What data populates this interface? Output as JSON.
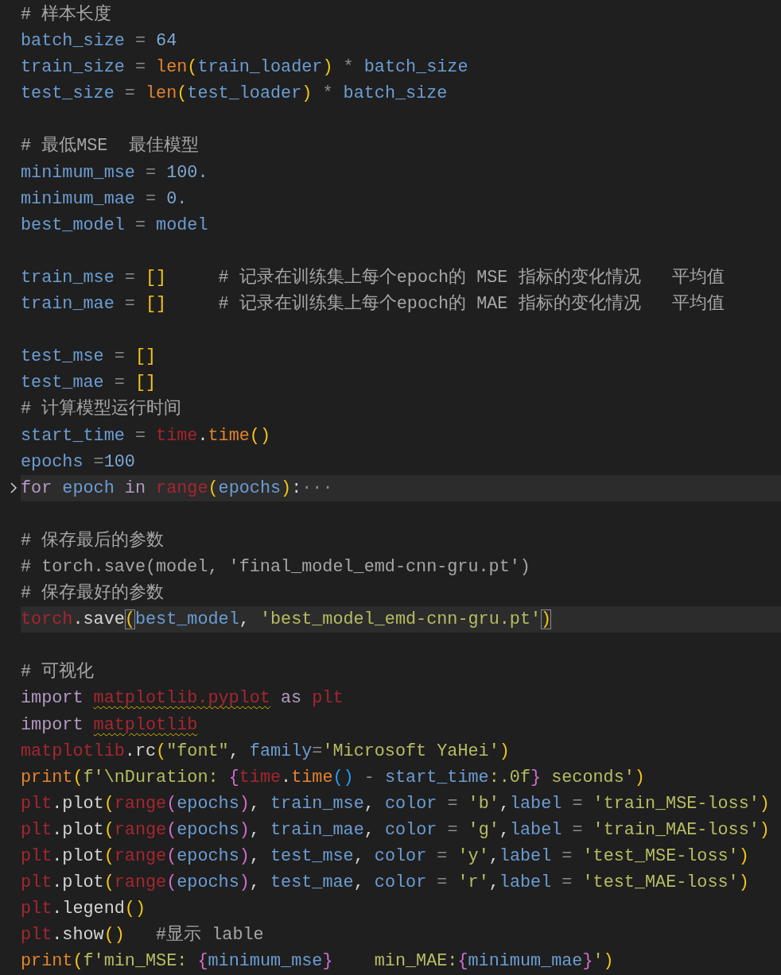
{
  "editor": {
    "lines": [
      {
        "kind": "code",
        "tokens": [
          {
            "text": "# 样本长度",
            "kind": "comment"
          }
        ]
      },
      {
        "kind": "code",
        "tokens": [
          {
            "text": "batch_size",
            "kind": "var"
          },
          {
            "text": " = ",
            "kind": "op"
          },
          {
            "text": "64",
            "kind": "num"
          }
        ]
      },
      {
        "kind": "code",
        "tokens": [
          {
            "text": "train_size",
            "kind": "var"
          },
          {
            "text": " = ",
            "kind": "op"
          },
          {
            "text": "len",
            "kind": "func"
          },
          {
            "text": "(",
            "kind": "bracket1"
          },
          {
            "text": "train_loader",
            "kind": "var"
          },
          {
            "text": ")",
            "kind": "bracket1"
          },
          {
            "text": " * ",
            "kind": "op"
          },
          {
            "text": "batch_size",
            "kind": "var"
          }
        ]
      },
      {
        "kind": "code",
        "tokens": [
          {
            "text": "test_size",
            "kind": "var"
          },
          {
            "text": " = ",
            "kind": "op"
          },
          {
            "text": "len",
            "kind": "func"
          },
          {
            "text": "(",
            "kind": "bracket1"
          },
          {
            "text": "test_loader",
            "kind": "var"
          },
          {
            "text": ")",
            "kind": "bracket1"
          },
          {
            "text": " * ",
            "kind": "op"
          },
          {
            "text": "batch_size",
            "kind": "var"
          }
        ]
      },
      {
        "kind": "blank"
      },
      {
        "kind": "code",
        "tokens": [
          {
            "text": "# 最低MSE  最佳模型",
            "kind": "comment"
          }
        ]
      },
      {
        "kind": "code",
        "tokens": [
          {
            "text": "minimum_mse",
            "kind": "var"
          },
          {
            "text": " = ",
            "kind": "op"
          },
          {
            "text": "100.",
            "kind": "num"
          }
        ]
      },
      {
        "kind": "code",
        "tokens": [
          {
            "text": "minimum_mae",
            "kind": "var"
          },
          {
            "text": " = ",
            "kind": "op"
          },
          {
            "text": "0.",
            "kind": "num"
          }
        ]
      },
      {
        "kind": "code",
        "tokens": [
          {
            "text": "best_model",
            "kind": "var"
          },
          {
            "text": " = ",
            "kind": "op"
          },
          {
            "text": "model",
            "kind": "var"
          }
        ]
      },
      {
        "kind": "blank"
      },
      {
        "kind": "code",
        "tokens": [
          {
            "text": "train_mse",
            "kind": "var"
          },
          {
            "text": " = ",
            "kind": "op"
          },
          {
            "text": "[]",
            "kind": "bracket1"
          },
          {
            "text": "     # 记录在训练集上每个epoch的 MSE 指标的变化情况   平均值",
            "kind": "comment"
          }
        ]
      },
      {
        "kind": "code",
        "tokens": [
          {
            "text": "train_mae",
            "kind": "var"
          },
          {
            "text": " = ",
            "kind": "op"
          },
          {
            "text": "[]",
            "kind": "bracket1"
          },
          {
            "text": "     # 记录在训练集上每个epoch的 MAE 指标的变化情况   平均值",
            "kind": "comment"
          }
        ]
      },
      {
        "kind": "blank"
      },
      {
        "kind": "code",
        "tokens": [
          {
            "text": "test_mse",
            "kind": "var"
          },
          {
            "text": " = ",
            "kind": "op"
          },
          {
            "text": "[]",
            "kind": "bracket1"
          }
        ]
      },
      {
        "kind": "code",
        "tokens": [
          {
            "text": "test_mae",
            "kind": "var"
          },
          {
            "text": " = ",
            "kind": "op"
          },
          {
            "text": "[]",
            "kind": "bracket1"
          }
        ]
      },
      {
        "kind": "code",
        "tokens": [
          {
            "text": "# 计算模型运行时间",
            "kind": "comment"
          }
        ]
      },
      {
        "kind": "code",
        "tokens": [
          {
            "text": "start_time",
            "kind": "var"
          },
          {
            "text": " = ",
            "kind": "op"
          },
          {
            "text": "time",
            "kind": "module"
          },
          {
            "text": ".",
            "kind": "plain"
          },
          {
            "text": "time",
            "kind": "func"
          },
          {
            "text": "()",
            "kind": "bracket1"
          }
        ]
      },
      {
        "kind": "code",
        "tokens": [
          {
            "text": "epochs",
            "kind": "var"
          },
          {
            "text": " =",
            "kind": "op"
          },
          {
            "text": "100",
            "kind": "num"
          }
        ]
      },
      {
        "kind": "code",
        "highlighted": true,
        "folded": true,
        "tokens": [
          {
            "text": "for ",
            "kind": "keyword"
          },
          {
            "text": "epoch",
            "kind": "var"
          },
          {
            "text": " in ",
            "kind": "keyword"
          },
          {
            "text": "range",
            "kind": "module"
          },
          {
            "text": "(",
            "kind": "bracket1"
          },
          {
            "text": "epochs",
            "kind": "var"
          },
          {
            "text": ")",
            "kind": "bracket1"
          },
          {
            "text": ":",
            "kind": "plain"
          },
          {
            "text": "···",
            "kind": "op"
          }
        ]
      },
      {
        "kind": "blank"
      },
      {
        "kind": "code",
        "tokens": [
          {
            "text": "# 保存最后的参数",
            "kind": "comment"
          }
        ]
      },
      {
        "kind": "code",
        "tokens": [
          {
            "text": "# torch.save(model, 'final_model_emd-cnn-gru.pt')",
            "kind": "comment"
          }
        ]
      },
      {
        "kind": "code",
        "tokens": [
          {
            "text": "# 保存最好的参数",
            "kind": "comment"
          }
        ]
      },
      {
        "kind": "code",
        "highlighted": true,
        "tokens": [
          {
            "text": "torch",
            "kind": "module"
          },
          {
            "text": ".save",
            "kind": "plain"
          },
          {
            "text": "(",
            "kind": "bracket1",
            "matched": true
          },
          {
            "text": "best_model",
            "kind": "var"
          },
          {
            "text": ", ",
            "kind": "plain"
          },
          {
            "text": "'best_model_emd-cnn-gru.pt'",
            "kind": "string"
          },
          {
            "text": ")",
            "kind": "bracket1",
            "matched": true
          }
        ]
      },
      {
        "kind": "blank"
      },
      {
        "kind": "code",
        "tokens": [
          {
            "text": "# 可视化",
            "kind": "comment"
          }
        ]
      },
      {
        "kind": "code",
        "tokens": [
          {
            "text": "import ",
            "kind": "keyword"
          },
          {
            "text": "matplotlib.pyplot",
            "kind": "module",
            "squiggle": true
          },
          {
            "text": " as ",
            "kind": "keyword"
          },
          {
            "text": "plt",
            "kind": "module"
          }
        ]
      },
      {
        "kind": "code",
        "tokens": [
          {
            "text": "import ",
            "kind": "keyword"
          },
          {
            "text": "matplotlib",
            "kind": "module",
            "squiggle": true
          }
        ]
      },
      {
        "kind": "code",
        "tokens": [
          {
            "text": "matplotlib",
            "kind": "module"
          },
          {
            "text": ".rc",
            "kind": "plain"
          },
          {
            "text": "(",
            "kind": "bracket1"
          },
          {
            "text": "\"font\"",
            "kind": "string"
          },
          {
            "text": ", ",
            "kind": "plain"
          },
          {
            "text": "family",
            "kind": "var"
          },
          {
            "text": "=",
            "kind": "op"
          },
          {
            "text": "'Microsoft YaHei'",
            "kind": "string"
          },
          {
            "text": ")",
            "kind": "bracket1"
          }
        ]
      },
      {
        "kind": "code",
        "tokens": [
          {
            "text": "print",
            "kind": "func"
          },
          {
            "text": "(",
            "kind": "bracket1"
          },
          {
            "text": "f'\\nDuration: ",
            "kind": "string"
          },
          {
            "text": "{",
            "kind": "bracket2"
          },
          {
            "text": "time",
            "kind": "module"
          },
          {
            "text": ".",
            "kind": "plain"
          },
          {
            "text": "time",
            "kind": "func"
          },
          {
            "text": "()",
            "kind": "bracket3"
          },
          {
            "text": " - ",
            "kind": "op"
          },
          {
            "text": "start_time",
            "kind": "var"
          },
          {
            "text": ":.0f",
            "kind": "string"
          },
          {
            "text": "}",
            "kind": "bracket2"
          },
          {
            "text": " seconds'",
            "kind": "string"
          },
          {
            "text": ")",
            "kind": "bracket1"
          }
        ]
      },
      {
        "kind": "code",
        "tokens": [
          {
            "text": "plt",
            "kind": "module"
          },
          {
            "text": ".plot",
            "kind": "plain"
          },
          {
            "text": "(",
            "kind": "bracket1"
          },
          {
            "text": "range",
            "kind": "module"
          },
          {
            "text": "(",
            "kind": "bracket2"
          },
          {
            "text": "epochs",
            "kind": "var"
          },
          {
            "text": ")",
            "kind": "bracket2"
          },
          {
            "text": ", ",
            "kind": "plain"
          },
          {
            "text": "train_mse",
            "kind": "var"
          },
          {
            "text": ", ",
            "kind": "plain"
          },
          {
            "text": "color",
            "kind": "var"
          },
          {
            "text": " = ",
            "kind": "op"
          },
          {
            "text": "'b'",
            "kind": "string"
          },
          {
            "text": ",",
            "kind": "plain"
          },
          {
            "text": "label",
            "kind": "var"
          },
          {
            "text": " = ",
            "kind": "op"
          },
          {
            "text": "'train_MSE-loss'",
            "kind": "string"
          },
          {
            "text": ")",
            "kind": "bracket1"
          }
        ]
      },
      {
        "kind": "code",
        "tokens": [
          {
            "text": "plt",
            "kind": "module"
          },
          {
            "text": ".plot",
            "kind": "plain"
          },
          {
            "text": "(",
            "kind": "bracket1"
          },
          {
            "text": "range",
            "kind": "module"
          },
          {
            "text": "(",
            "kind": "bracket2"
          },
          {
            "text": "epochs",
            "kind": "var"
          },
          {
            "text": ")",
            "kind": "bracket2"
          },
          {
            "text": ", ",
            "kind": "plain"
          },
          {
            "text": "train_mae",
            "kind": "var"
          },
          {
            "text": ", ",
            "kind": "plain"
          },
          {
            "text": "color",
            "kind": "var"
          },
          {
            "text": " = ",
            "kind": "op"
          },
          {
            "text": "'g'",
            "kind": "string"
          },
          {
            "text": ",",
            "kind": "plain"
          },
          {
            "text": "label",
            "kind": "var"
          },
          {
            "text": " = ",
            "kind": "op"
          },
          {
            "text": "'train_MAE-loss'",
            "kind": "string"
          },
          {
            "text": ")",
            "kind": "bracket1"
          }
        ]
      },
      {
        "kind": "code",
        "tokens": [
          {
            "text": "plt",
            "kind": "module"
          },
          {
            "text": ".plot",
            "kind": "plain"
          },
          {
            "text": "(",
            "kind": "bracket1"
          },
          {
            "text": "range",
            "kind": "module"
          },
          {
            "text": "(",
            "kind": "bracket2"
          },
          {
            "text": "epochs",
            "kind": "var"
          },
          {
            "text": ")",
            "kind": "bracket2"
          },
          {
            "text": ", ",
            "kind": "plain"
          },
          {
            "text": "test_mse",
            "kind": "var"
          },
          {
            "text": ", ",
            "kind": "plain"
          },
          {
            "text": "color",
            "kind": "var"
          },
          {
            "text": " = ",
            "kind": "op"
          },
          {
            "text": "'y'",
            "kind": "string"
          },
          {
            "text": ",",
            "kind": "plain"
          },
          {
            "text": "label",
            "kind": "var"
          },
          {
            "text": " = ",
            "kind": "op"
          },
          {
            "text": "'test_MSE-loss'",
            "kind": "string"
          },
          {
            "text": ")",
            "kind": "bracket1"
          }
        ]
      },
      {
        "kind": "code",
        "tokens": [
          {
            "text": "plt",
            "kind": "module"
          },
          {
            "text": ".plot",
            "kind": "plain"
          },
          {
            "text": "(",
            "kind": "bracket1"
          },
          {
            "text": "range",
            "kind": "module"
          },
          {
            "text": "(",
            "kind": "bracket2"
          },
          {
            "text": "epochs",
            "kind": "var"
          },
          {
            "text": ")",
            "kind": "bracket2"
          },
          {
            "text": ", ",
            "kind": "plain"
          },
          {
            "text": "test_mae",
            "kind": "var"
          },
          {
            "text": ", ",
            "kind": "plain"
          },
          {
            "text": "color",
            "kind": "var"
          },
          {
            "text": " = ",
            "kind": "op"
          },
          {
            "text": "'r'",
            "kind": "string"
          },
          {
            "text": ",",
            "kind": "plain"
          },
          {
            "text": "label",
            "kind": "var"
          },
          {
            "text": " = ",
            "kind": "op"
          },
          {
            "text": "'test_MAE-loss'",
            "kind": "string"
          },
          {
            "text": ")",
            "kind": "bracket1"
          }
        ]
      },
      {
        "kind": "code",
        "tokens": [
          {
            "text": "plt",
            "kind": "module"
          },
          {
            "text": ".legend",
            "kind": "plain"
          },
          {
            "text": "()",
            "kind": "bracket1"
          }
        ]
      },
      {
        "kind": "code",
        "tokens": [
          {
            "text": "plt",
            "kind": "module"
          },
          {
            "text": ".show",
            "kind": "plain"
          },
          {
            "text": "()",
            "kind": "bracket1"
          },
          {
            "text": "   #显示 lable",
            "kind": "comment"
          }
        ]
      },
      {
        "kind": "code",
        "tokens": [
          {
            "text": "print",
            "kind": "func"
          },
          {
            "text": "(",
            "kind": "bracket1"
          },
          {
            "text": "f'min_MSE: ",
            "kind": "string"
          },
          {
            "text": "{",
            "kind": "bracket2"
          },
          {
            "text": "minimum_mse",
            "kind": "var"
          },
          {
            "text": "}",
            "kind": "bracket2"
          },
          {
            "text": "    min_MAE:",
            "kind": "string"
          },
          {
            "text": "{",
            "kind": "bracket2"
          },
          {
            "text": "minimum_mae",
            "kind": "var"
          },
          {
            "text": "}",
            "kind": "bracket2"
          },
          {
            "text": "'",
            "kind": "string"
          },
          {
            "text": ")",
            "kind": "bracket1"
          }
        ]
      }
    ]
  }
}
